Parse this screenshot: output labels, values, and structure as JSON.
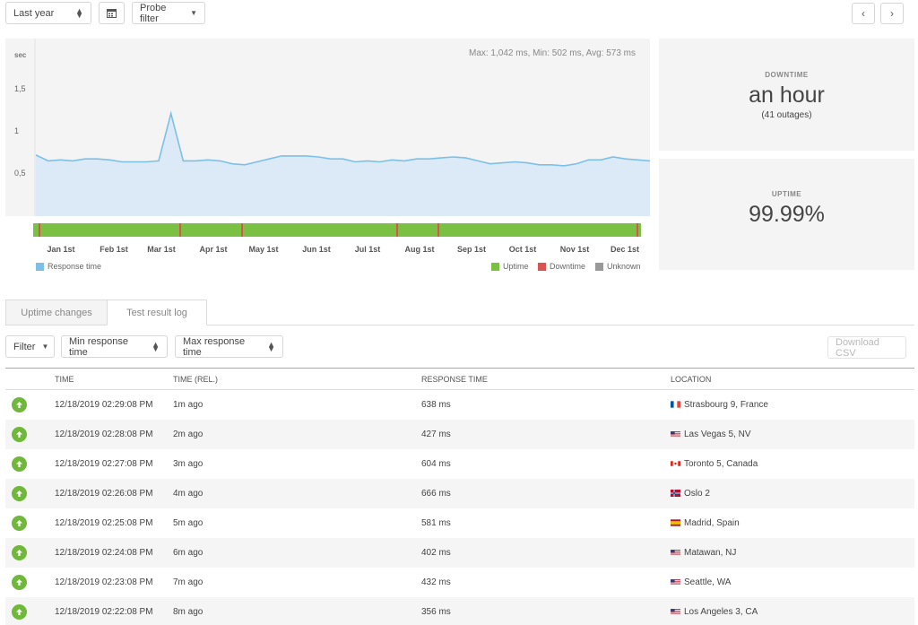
{
  "toolbar": {
    "range_label": "Last year",
    "probe_filter_label": "Probe filter"
  },
  "chart": {
    "stats_text": "Max: 1,042 ms, Min: 502 ms, Avg: 573 ms",
    "y_unit": "sec",
    "y_ticks": [
      "1,5",
      "1",
      "0,5"
    ],
    "x_ticks": [
      "Jan 1st",
      "Feb 1st",
      "Mar 1st",
      "Apr 1st",
      "May 1st",
      "Jun 1st",
      "Jul 1st",
      "Aug 1st",
      "Sep 1st",
      "Oct 1st",
      "Nov 1st",
      "Dec 1st"
    ],
    "legend": {
      "response_time": "Response time",
      "uptime": "Uptime",
      "downtime": "Downtime",
      "unknown": "Unknown"
    },
    "colors": {
      "line": "#7cc0e8",
      "fill": "#dbeaf6",
      "uptime": "#7ac143",
      "downtime": "#d9534f",
      "unknown": "#999999"
    }
  },
  "chart_data": {
    "type": "area",
    "ylabel": "sec",
    "ylim": [
      0,
      1.8
    ],
    "series": [
      {
        "name": "Response time",
        "values": [
          0.62,
          0.56,
          0.57,
          0.56,
          0.58,
          0.58,
          0.57,
          0.55,
          0.55,
          0.55,
          0.56,
          1.04,
          0.56,
          0.56,
          0.57,
          0.56,
          0.53,
          0.52,
          0.55,
          0.58,
          0.61,
          0.61,
          0.61,
          0.6,
          0.58,
          0.58,
          0.55,
          0.56,
          0.55,
          0.57,
          0.56,
          0.58,
          0.58,
          0.59,
          0.6,
          0.59,
          0.56,
          0.53,
          0.54,
          0.55,
          0.54,
          0.52,
          0.52,
          0.51,
          0.53,
          0.57,
          0.57,
          0.6,
          0.58,
          0.57,
          0.56
        ]
      }
    ]
  },
  "downtime": {
    "label": "DOWNTIME",
    "value": "an hour",
    "sub": "(41 outages)"
  },
  "uptime": {
    "label": "UPTIME",
    "value": "99.99%"
  },
  "tabs": [
    "Uptime changes",
    "Test result log"
  ],
  "filters": {
    "filter_label": "Filter",
    "min_label": "Min response time",
    "max_label": "Max response time",
    "download_label": "Download CSV"
  },
  "table": {
    "headers": [
      "TIME",
      "TIME (REL.)",
      "RESPONSE TIME",
      "LOCATION"
    ],
    "rows": [
      {
        "time": "12/18/2019 02:29:08 PM",
        "rel": "1m ago",
        "resp": "638 ms",
        "loc": "Strasbourg 9, France",
        "flag": "fr"
      },
      {
        "time": "12/18/2019 02:28:08 PM",
        "rel": "2m ago",
        "resp": "427 ms",
        "loc": "Las Vegas 5, NV",
        "flag": "us"
      },
      {
        "time": "12/18/2019 02:27:08 PM",
        "rel": "3m ago",
        "resp": "604 ms",
        "loc": "Toronto 5, Canada",
        "flag": "ca"
      },
      {
        "time": "12/18/2019 02:26:08 PM",
        "rel": "4m ago",
        "resp": "666 ms",
        "loc": "Oslo 2",
        "flag": "no"
      },
      {
        "time": "12/18/2019 02:25:08 PM",
        "rel": "5m ago",
        "resp": "581 ms",
        "loc": "Madrid, Spain",
        "flag": "es"
      },
      {
        "time": "12/18/2019 02:24:08 PM",
        "rel": "6m ago",
        "resp": "402 ms",
        "loc": "Matawan, NJ",
        "flag": "us"
      },
      {
        "time": "12/18/2019 02:23:08 PM",
        "rel": "7m ago",
        "resp": "432 ms",
        "loc": "Seattle, WA",
        "flag": "us"
      },
      {
        "time": "12/18/2019 02:22:08 PM",
        "rel": "8m ago",
        "resp": "356 ms",
        "loc": "Los Angeles 3, CA",
        "flag": "us"
      }
    ]
  }
}
